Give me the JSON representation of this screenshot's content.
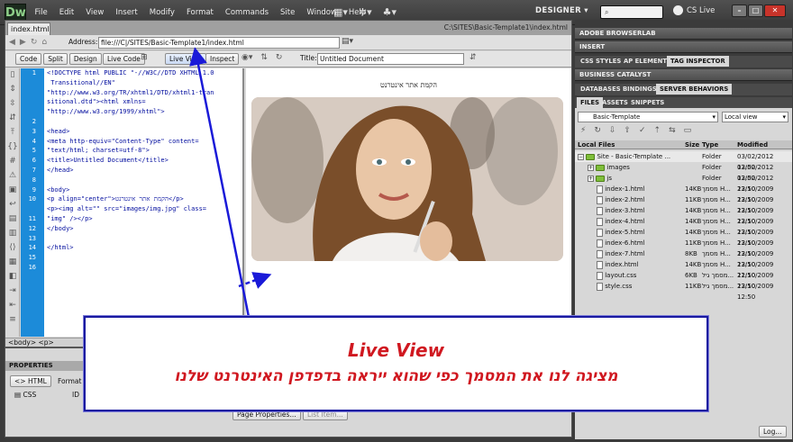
{
  "menubar": {
    "logo": "Dw",
    "items": [
      "File",
      "Edit",
      "View",
      "Insert",
      "Modify",
      "Format",
      "Commands",
      "Site",
      "Window",
      "Help"
    ],
    "workspace": "DESIGNER",
    "cs_live": "CS Live"
  },
  "document": {
    "tab": "index.html",
    "path": "C:\\SITES\\Basic-Template1\\index.html",
    "address_label": "Address:",
    "address": "file:///C|/SITES/Basic-Template1/index.html",
    "buttons": {
      "code": "Code",
      "split": "Split",
      "design": "Design",
      "live_code": "Live Code",
      "live_view": "Live View",
      "inspect": "Inspect"
    },
    "title_label": "Title:",
    "title_value": "Untitled Document",
    "line_numbers": [
      "1",
      "",
      "",
      "",
      "",
      "2",
      "3",
      "4",
      "5",
      "6",
      "7",
      "8",
      "9",
      "10",
      "",
      "11",
      "12",
      "13",
      "14",
      "15",
      "16"
    ],
    "code_lines": [
      "<!DOCTYPE html PUBLIC \"-//W3C//DTD XHTML 1.0",
      " Transitional//EN\"",
      "\"http://www.w3.org/TR/xhtml1/DTD/xhtml1-tran",
      "sitional.dtd\"><html xmlns=",
      "\"http://www.w3.org/1999/xhtml\">",
      "",
      "<head>",
      "<meta http-equiv=\"Content-Type\" content=",
      "\"text/html; charset=utf-8\">",
      "<title>Untitled Document</title>",
      "</head>",
      "",
      "<body>",
      "<p align=\"center\">הקמת אתר אינטרנט</p>",
      "<p><img alt=\"\" src=\"images/img.jpg\" class=",
      "\"img\" /></p>",
      "</body>",
      "",
      "</html>",
      "",
      ""
    ],
    "design_heading": "הקמת אתר אינטרנט",
    "status": "<body> <p>"
  },
  "properties": {
    "title": "PROPERTIES",
    "html_btn": "HTML",
    "css_btn": "CSS",
    "format_label": "Format",
    "id_label": "ID",
    "page_props": "Page Properties...",
    "list_item": "List Item..."
  },
  "panels": {
    "browserlab": "ADOBE BROWSERLAB",
    "insert": "INSERT",
    "tabs1": [
      "CSS STYLES",
      "AP ELEMENTS",
      "TAG INSPECTOR"
    ],
    "business": "BUSINESS CATALYST",
    "tabs2": [
      "DATABASES",
      "BINDINGS",
      "SERVER BEHAVIORS"
    ],
    "tabs3": [
      "FILES",
      "ASSETS",
      "SNIPPETS"
    ],
    "site_select": "Basic-Template",
    "view_select": "Local view",
    "columns": [
      "Local Files",
      "Size",
      "Type",
      "Modified"
    ],
    "files": [
      {
        "name": "Site - Basic-Template ...",
        "size": "",
        "type": "Folder",
        "modified": "03/02/2012 12:50"
      },
      {
        "name": "images",
        "size": "",
        "type": "Folder",
        "modified": "03/02/2012 12:50"
      },
      {
        "name": "js",
        "size": "",
        "type": "Folder",
        "modified": "03/02/2012 12:50"
      },
      {
        "name": "index-1.html",
        "size": "14KB",
        "type": "מסמך H...",
        "modified": "23/10/2009 12:50"
      },
      {
        "name": "index-2.html",
        "size": "11KB",
        "type": "מסמך H...",
        "modified": "23/10/2009 12:50"
      },
      {
        "name": "index-3.html",
        "size": "14KB",
        "type": "מסמך H...",
        "modified": "23/10/2009 12:50"
      },
      {
        "name": "index-4.html",
        "size": "14KB",
        "type": "מסמך H...",
        "modified": "23/10/2009 12:50"
      },
      {
        "name": "index-5.html",
        "size": "14KB",
        "type": "מסמך H...",
        "modified": "23/10/2009 12:50"
      },
      {
        "name": "index-6.html",
        "size": "11KB",
        "type": "מסמך H...",
        "modified": "23/10/2009 12:50"
      },
      {
        "name": "index-7.html",
        "size": "8KB",
        "type": "מסמך H...",
        "modified": "23/10/2009 12:50"
      },
      {
        "name": "index.html",
        "size": "14KB",
        "type": "מסמך H...",
        "modified": "23/10/2009 12:50"
      },
      {
        "name": "layout.css",
        "size": "6KB",
        "type": "מסמך גיל...",
        "modified": "21/10/2009 12:50"
      },
      {
        "name": "style.css",
        "size": "11KB",
        "type": "מסמך גיל...",
        "modified": "23/10/2009 12:50"
      }
    ],
    "log_btn": "Log..."
  },
  "callout": {
    "title": "Live View",
    "text": "מציגה לנו את המסמך כפי שהוא ייראה בדפדפן האינטרנט שלנו"
  },
  "colors": {
    "accent_red": "#d01820",
    "arrow_blue": "#1a1ad8",
    "gutter": "#1c8bd9"
  }
}
